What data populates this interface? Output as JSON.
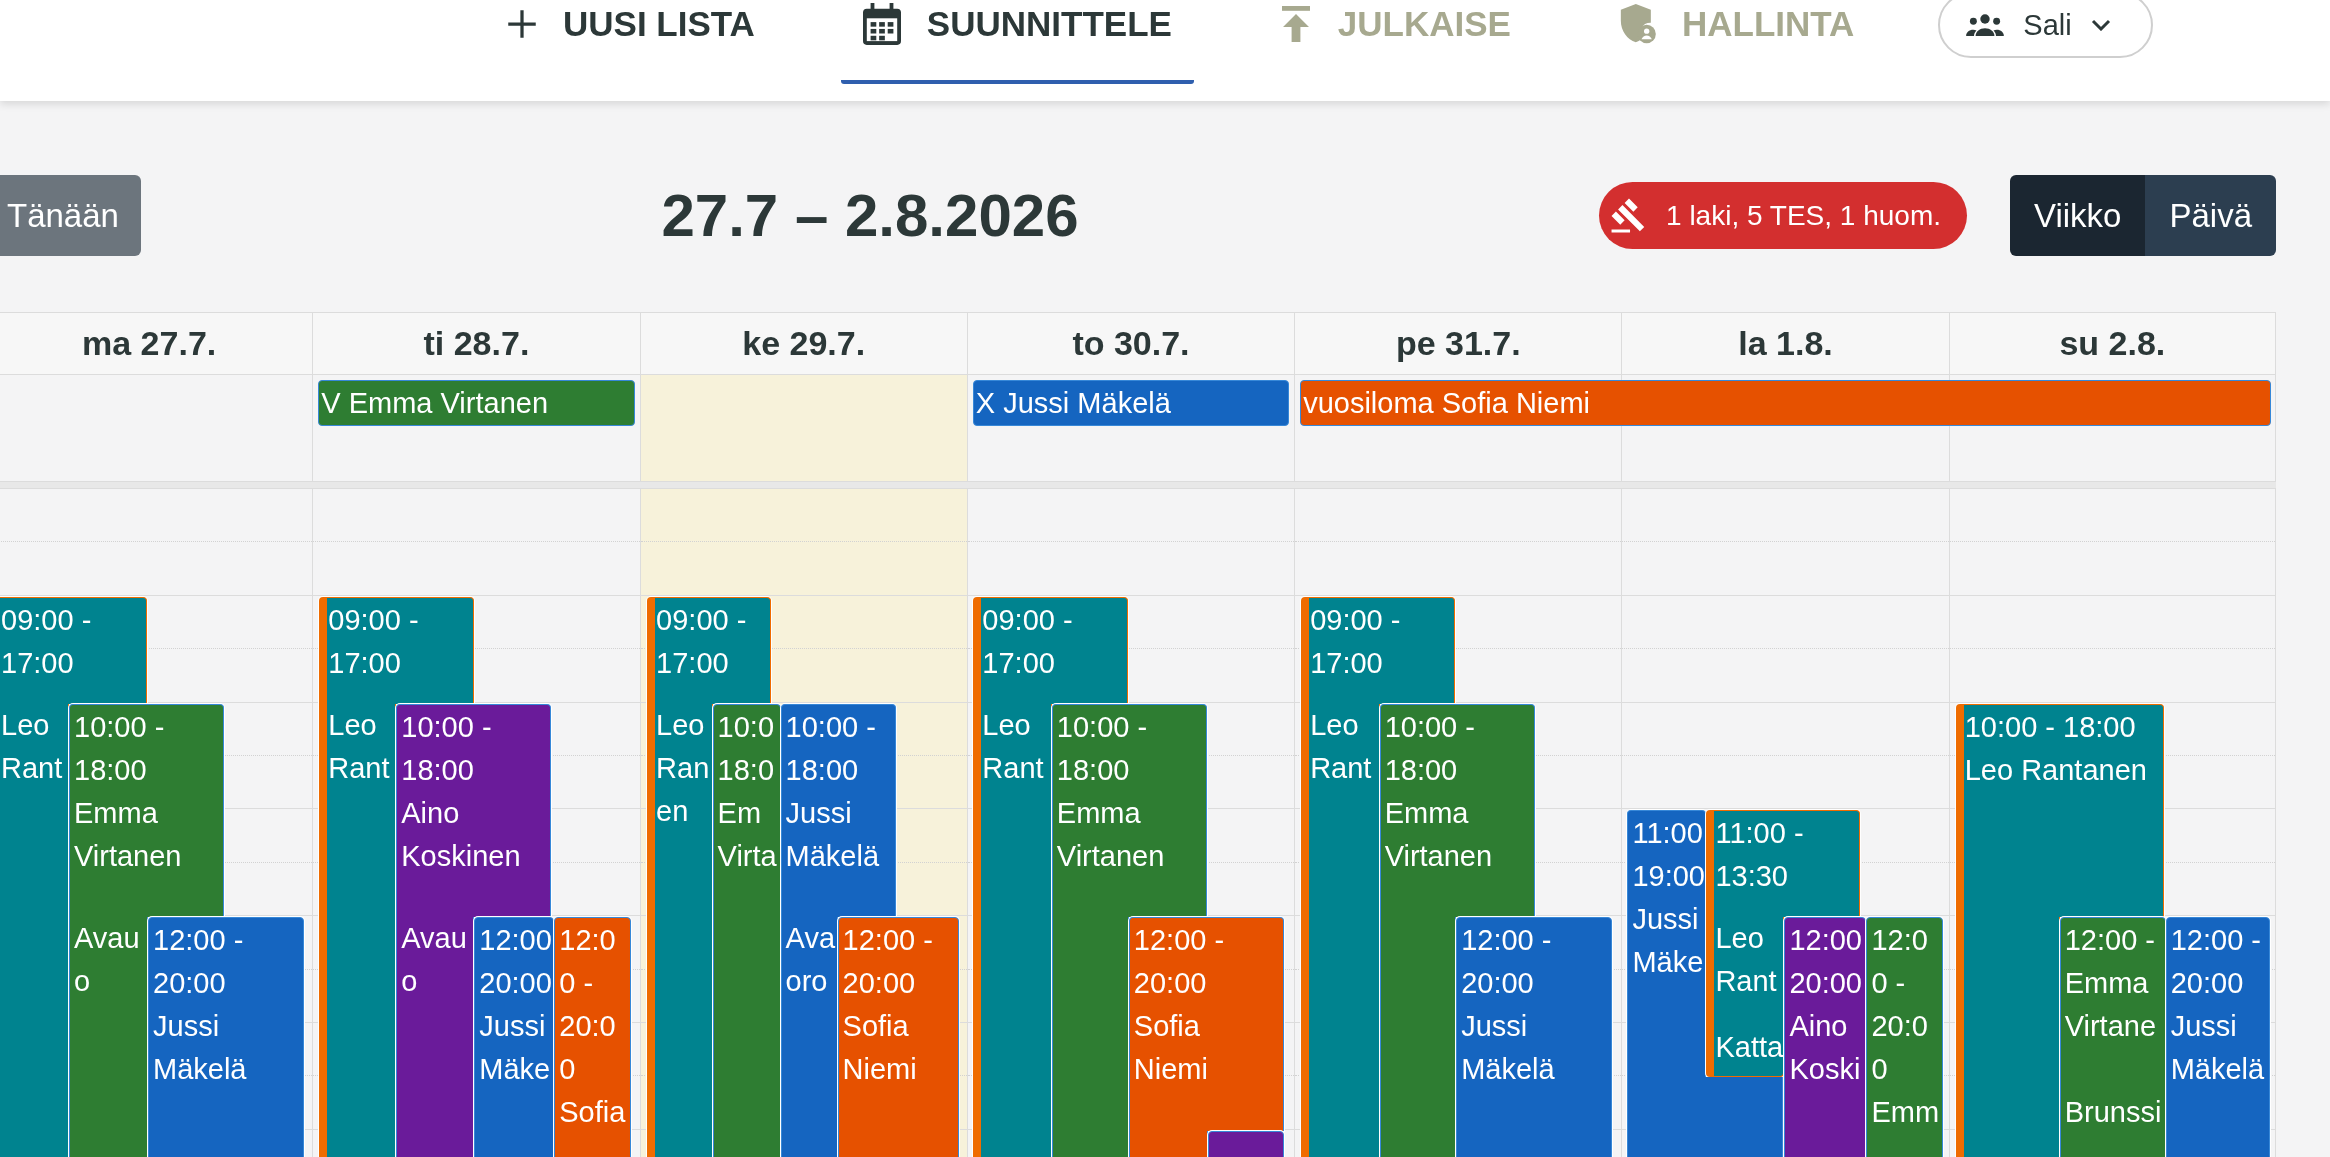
{
  "nav_tabs": [
    {
      "label": "UUSI LISTA",
      "selected": false,
      "disabled": false
    },
    {
      "label": "SUUNNITTELE",
      "selected": true,
      "disabled": false
    },
    {
      "label": "JULKAISE",
      "selected": false,
      "disabled": true
    },
    {
      "label": "HALLINTA",
      "selected": false,
      "disabled": true
    }
  ],
  "location": {
    "label": "Sali"
  },
  "toolbar": {
    "today_button": "Tänään",
    "title": "27.7 – 2.8.2026",
    "warnings": "1 laki, 5 TES, 1 huom.",
    "views": [
      {
        "label": "Viikko",
        "selected": true
      },
      {
        "label": "Päivä",
        "selected": false
      }
    ]
  },
  "all_day_events": [
    {
      "label": "V Emma Virtanen",
      "color": "#2e7d32"
    },
    {
      "label": "X Jussi Mäkelä",
      "color": "#1565c0"
    },
    {
      "label": "vuosiloma Sofia Niemi",
      "color": "#e65100"
    }
  ],
  "days": [
    {
      "label": "ma 27.7.",
      "today": false,
      "events": [
        {
          "time": "09:00 - 17:00",
          "name": "Leo Rant",
          "color": "#00838f",
          "flagged": true
        },
        {
          "time": "10:00 - 18:00",
          "name": "Emma Virtanen",
          "note": "Avau o",
          "color": "#2e7d32",
          "flagged": false
        },
        {
          "time": "12:00 - 20:00",
          "name": "Jussi Mäkelä",
          "color": "#1565c0",
          "flagged": false
        }
      ]
    },
    {
      "label": "ti 28.7.",
      "today": false,
      "events": [
        {
          "time": "09:00 - 17:00",
          "name": "Leo Rant",
          "color": "#00838f",
          "flagged": true
        },
        {
          "time": "10:00 - 18:00",
          "name": "Aino Koskinen",
          "note": "Avau o",
          "color": "#6a1b9a",
          "flagged": false
        },
        {
          "time": "12:00 20:00",
          "name": "Jussi Mäke",
          "color": "#1565c0",
          "flagged": false
        },
        {
          "time": "12:00 - 20:00",
          "name": "Sofia",
          "color": "#e65100",
          "flagged": false
        }
      ]
    },
    {
      "label": "ke 29.7.",
      "today": true,
      "events": [
        {
          "time": "09:00 - 17:00",
          "name": "Leo Ran en",
          "color": "#00838f",
          "flagged": true
        },
        {
          "time": "10:0 18:0",
          "name": "Em Virta",
          "color": "#2e7d32",
          "flagged": false
        },
        {
          "time": "10:00 - 18:00",
          "name": "Jussi Mäkelä",
          "note": "Ava oro",
          "color": "#1565c0",
          "flagged": false
        },
        {
          "time": "12:00 - 20:00",
          "name": "Sofia Niemi",
          "color": "#e65100",
          "flagged": false
        }
      ]
    },
    {
      "label": "to 30.7.",
      "today": false,
      "events": [
        {
          "time": "09:00 - 17:00",
          "name": "Leo Rant",
          "color": "#00838f",
          "flagged": true
        },
        {
          "time": "10:00 - 18:00",
          "name": "Emma Virtanen",
          "color": "#2e7d32",
          "flagged": false
        },
        {
          "time": "12:00 - 20:00",
          "name": "Sofia Niemi",
          "color": "#e65100",
          "flagged": false
        },
        {
          "color": "#6a1b9a",
          "flagged": false
        }
      ]
    },
    {
      "label": "pe 31.7.",
      "today": false,
      "events": [
        {
          "time": "09:00 - 17:00",
          "name": "Leo Rant",
          "color": "#00838f",
          "flagged": true
        },
        {
          "time": "10:00 - 18:00",
          "name": "Emma Virtanen",
          "color": "#2e7d32",
          "flagged": false
        },
        {
          "time": "12:00 - 20:00",
          "name": "Jussi Mäkelä",
          "color": "#1565c0",
          "flagged": false
        }
      ]
    },
    {
      "label": "la 1.8.",
      "today": false,
      "events": [
        {
          "time": "11:00 19:00",
          "name": "Jussi Mäke",
          "color": "#1565c0",
          "flagged": false
        },
        {
          "time": "11:00 - 13:30",
          "name": "Leo Rant",
          "note": "Katta",
          "color": "#00838f",
          "flagged": true
        },
        {
          "time": "12:00 20:00",
          "name": "Aino Koski",
          "color": "#6a1b9a",
          "flagged": false
        },
        {
          "time": "12:00 - 20:00",
          "name": "Emm",
          "color": "#2e7d32",
          "flagged": false
        }
      ]
    },
    {
      "label": "su 2.8.",
      "today": false,
      "events": [
        {
          "time": "10:00 - 18:00",
          "name": "Leo Rantanen",
          "color": "#00838f",
          "flagged": true
        },
        {
          "time": "12:00 -",
          "name": "Emma Virtane",
          "note": "Brunssi",
          "color": "#2e7d32",
          "flagged": false
        },
        {
          "time": "12:00 - 20:00",
          "name": "Jussi Mäkelä",
          "color": "#1565c0",
          "flagged": false
        }
      ]
    }
  ]
}
